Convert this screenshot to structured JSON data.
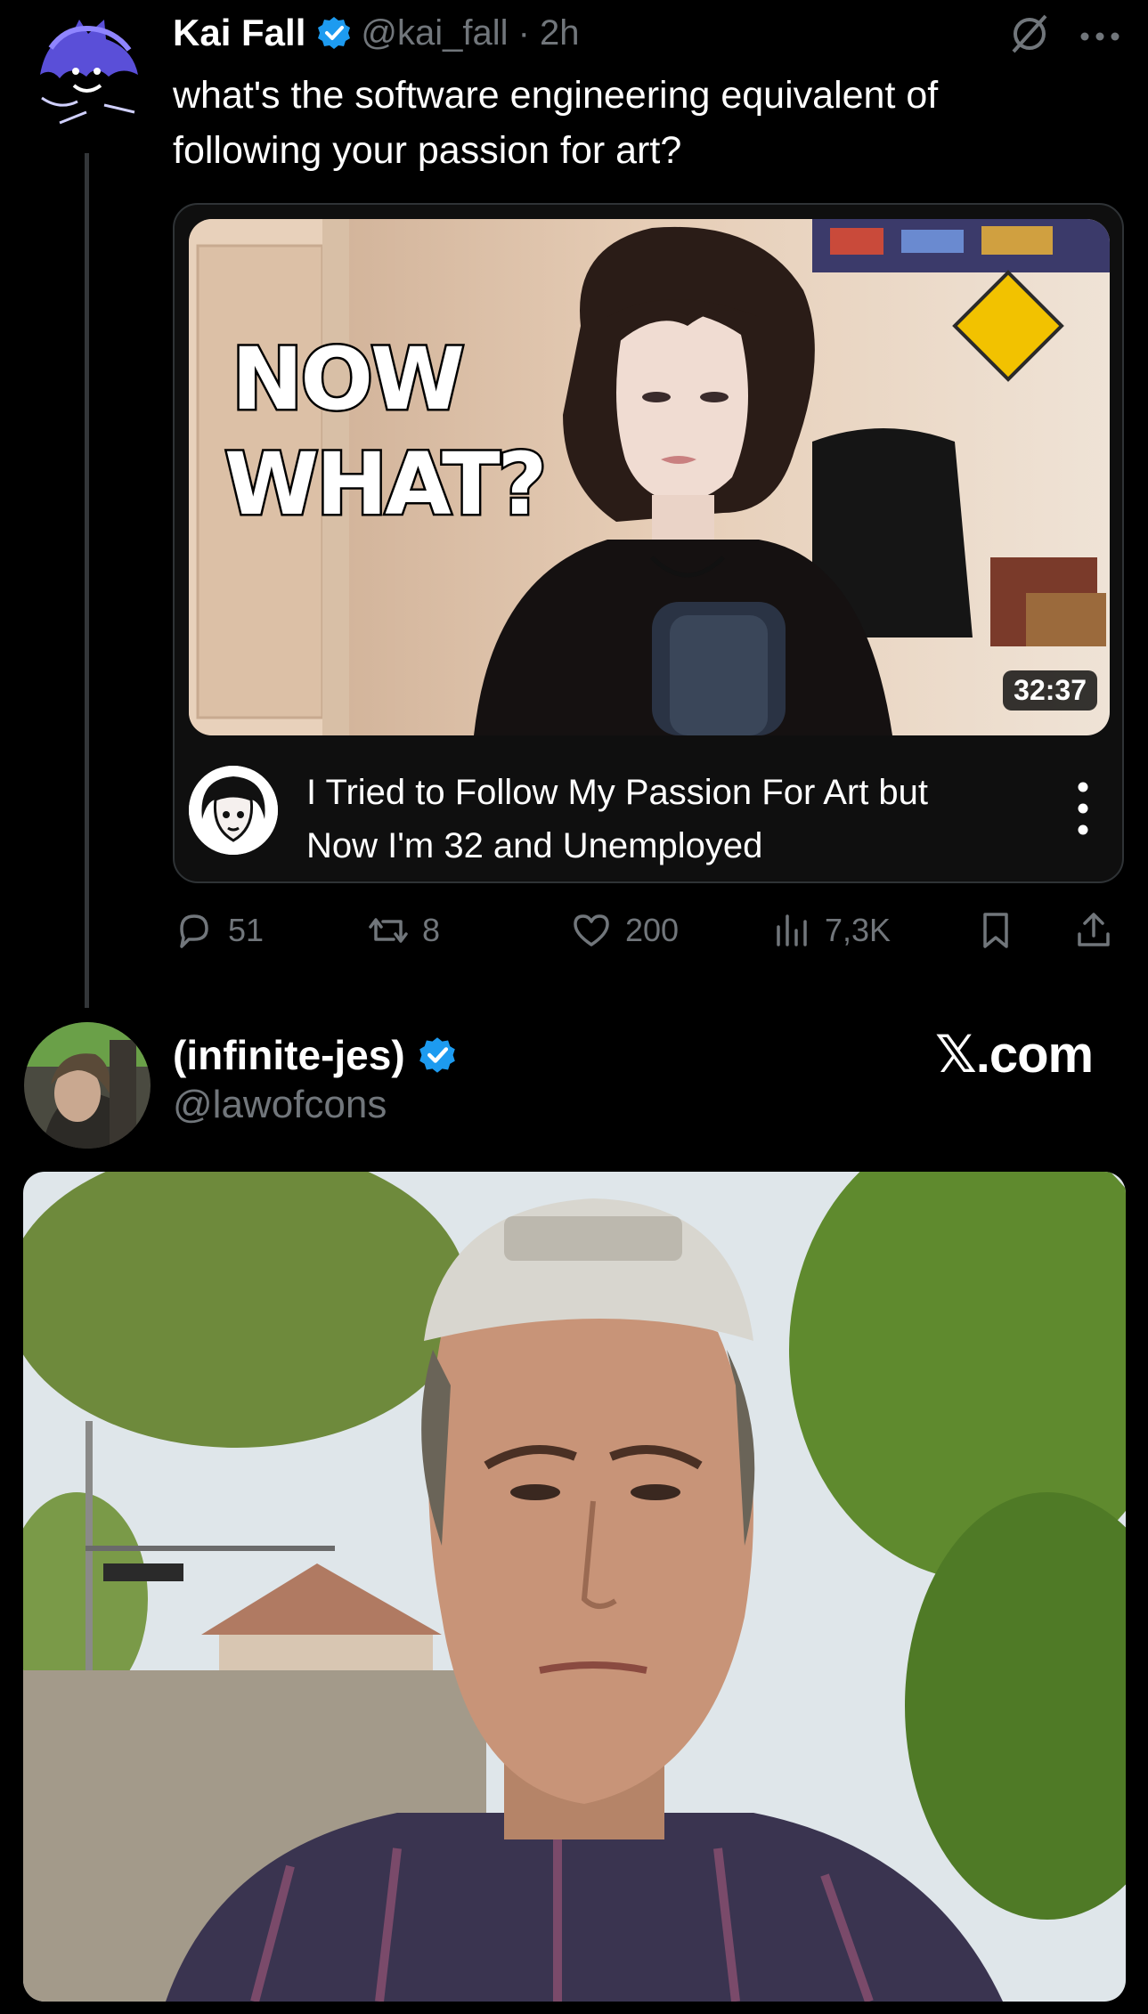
{
  "tweet": {
    "author_name": "Kai Fall",
    "handle_time": "@kai_fall · 2h",
    "text": "what's the software engineering equivalent of\nfollowing your passion for art?",
    "verified_icon": "verified-badge-icon",
    "video_card": {
      "thumbnail_text_line1": "NOW",
      "thumbnail_text_line2": "WHAT?",
      "duration": "32:37",
      "title": "I Tried to Follow My Passion For Art but\nNow I'm 32 and Unemployed"
    },
    "actions": {
      "replies": "51",
      "reposts": "8",
      "likes": "200",
      "views": "7,3K"
    }
  },
  "quoted": {
    "name": "(infinite-jes)",
    "handle": "@lawofcons",
    "watermark": "𝕏.com"
  },
  "colors": {
    "background": "#000000",
    "secondary_text": "#71767b",
    "verified_blue": "#1d9bf0",
    "divider": "#2f3336"
  }
}
